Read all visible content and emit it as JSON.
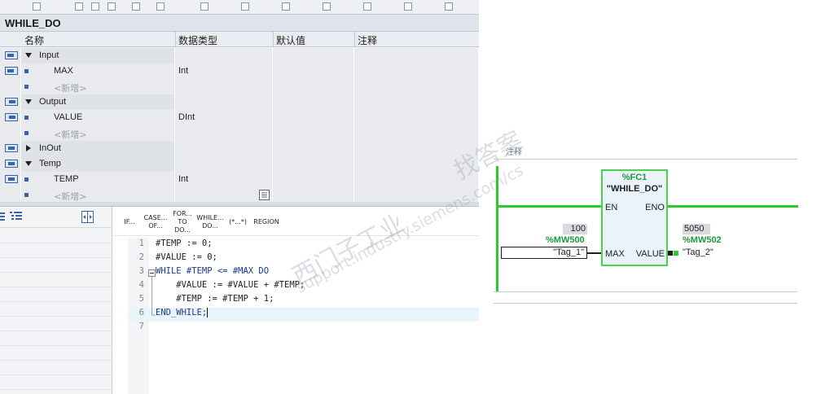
{
  "block": {
    "title": "WHILE_DO"
  },
  "interface": {
    "columns": [
      "名称",
      "数据类型",
      "默认值",
      "注释"
    ],
    "rows": [
      {
        "kind": "section",
        "name": "Input",
        "expanded": true,
        "type": ""
      },
      {
        "kind": "var",
        "name": "MAX",
        "type": "Int"
      },
      {
        "kind": "placeholder",
        "name": "<新增>",
        "type": ""
      },
      {
        "kind": "section",
        "name": "Output",
        "expanded": true,
        "type": ""
      },
      {
        "kind": "var",
        "name": "VALUE",
        "type": "DInt"
      },
      {
        "kind": "placeholder",
        "name": "<新增>",
        "type": ""
      },
      {
        "kind": "section",
        "name": "InOut",
        "expanded": false,
        "type": ""
      },
      {
        "kind": "section",
        "name": "Temp",
        "expanded": true,
        "type": ""
      },
      {
        "kind": "var",
        "name": "TEMP",
        "type": "Int"
      },
      {
        "kind": "placeholder",
        "name": "<新增>",
        "type": ""
      }
    ]
  },
  "code_toolbar": {
    "keywords": [
      {
        "label": "IF..."
      },
      {
        "label": "CASE... OF..."
      },
      {
        "label": "FOR... TO DO..."
      },
      {
        "label": "WHILE... DO..."
      },
      {
        "label": "(*...*)"
      },
      {
        "label": "REGION"
      }
    ]
  },
  "code": {
    "lines": [
      {
        "num": "1",
        "text": "#TEMP := 0;"
      },
      {
        "num": "2",
        "text": "#VALUE := 0;"
      },
      {
        "num": "3",
        "text": "WHILE #TEMP <= #MAX DO"
      },
      {
        "num": "4",
        "text": "    #VALUE := #VALUE + #TEMP;"
      },
      {
        "num": "5",
        "text": "    #TEMP := #TEMP + 1;"
      },
      {
        "num": "6",
        "text": "END_WHILE;"
      },
      {
        "num": "7",
        "text": ""
      }
    ],
    "current_line": "6"
  },
  "diagram": {
    "comment_label": "注释",
    "block_address": "%FC1",
    "block_name": "\"WHILE_DO\"",
    "pin_en": "EN",
    "pin_eno": "ENO",
    "pin_max": "MAX",
    "pin_value": "VALUE",
    "in_value": "100",
    "in_address": "%MW500",
    "in_tag": "\"Tag_1\"",
    "out_value": "5050",
    "out_address": "%MW502",
    "out_tag": "\"Tag_2\"",
    "accent_green": "#2ccb2c"
  },
  "watermark": {
    "line1": "西门子工业",
    "line2": "support.industry.siemens.com/cs",
    "line3": "找答案"
  }
}
